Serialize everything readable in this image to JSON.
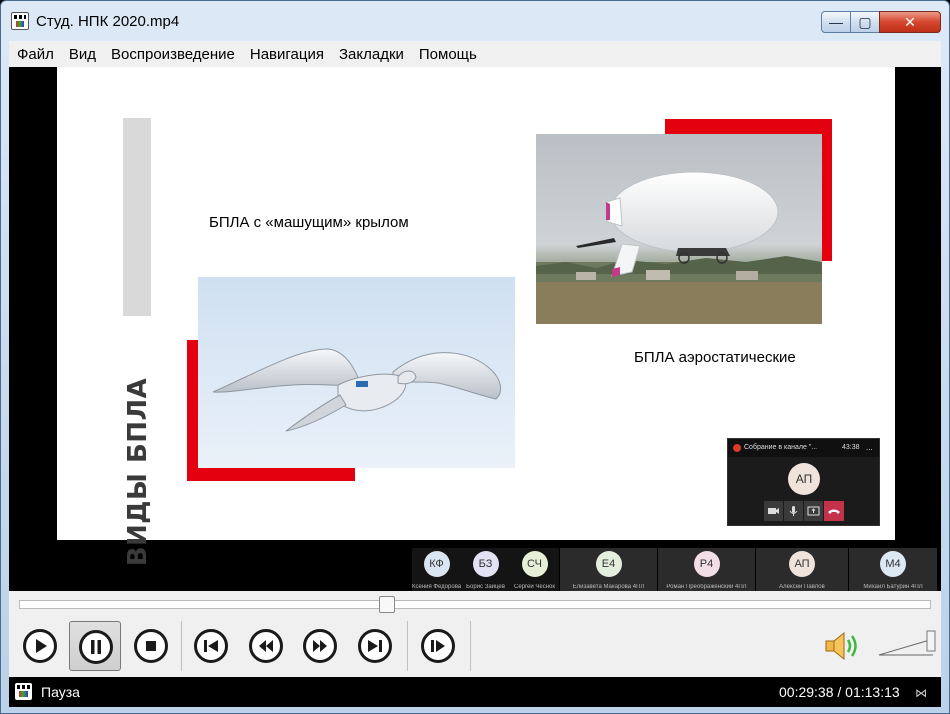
{
  "window": {
    "title": "Студ. НПК 2020.mp4"
  },
  "title_buttons": {
    "minimize": "—",
    "maximize": "▢",
    "close": "✕"
  },
  "menu": [
    "Файл",
    "Вид",
    "Воспроизведение",
    "Навигация",
    "Закладки",
    "Помощь"
  ],
  "slide": {
    "heading": "ВИДЫ БПЛА",
    "caption_left": "БПЛА с «машущим» крылом",
    "caption_right": "БПЛА аэростатические",
    "accent_color": "#e3000f"
  },
  "meeting": {
    "title": "Собрание в канале \"...",
    "time": "43:38",
    "more": "...",
    "avatar": "АП",
    "controls": [
      "camera-icon",
      "mic-icon",
      "share-icon",
      "hangup-icon"
    ]
  },
  "participants": [
    {
      "initials": "КФ",
      "name": "Ксения Федорова",
      "color": "#d9e6f2"
    },
    {
      "initials": "БЗ",
      "name": "Борис Зайцев",
      "color": "#e3e1f4"
    },
    {
      "initials": "СЧ",
      "name": "Сергей Чеснок",
      "color": "#e6f0d8"
    },
    {
      "initials": "Е4",
      "name": "Елизавета Макарова 4ПЛ",
      "color": "#e3efdc"
    },
    {
      "initials": "Р4",
      "name": "Роман Преображенский 4ПЛ",
      "color": "#f3dde6"
    },
    {
      "initials": "АП",
      "name": "Алексей Павлов",
      "color": "#efe3db"
    },
    {
      "initials": "М4",
      "name": "Михаил Батурин 4ПЛ",
      "color": "#dce8f4"
    }
  ],
  "player": {
    "progress_fraction": 0.404,
    "volume_fraction": 0.9,
    "buttons": [
      "play-icon",
      "pause-icon",
      "stop-icon",
      "skip-back-icon",
      "rewind-icon",
      "fast-forward-icon",
      "skip-forward-icon",
      "frame-step-icon"
    ]
  },
  "status": {
    "state": "Пауза",
    "time_display": "00:29:38 / 01:13:13",
    "resize": "⋈"
  }
}
